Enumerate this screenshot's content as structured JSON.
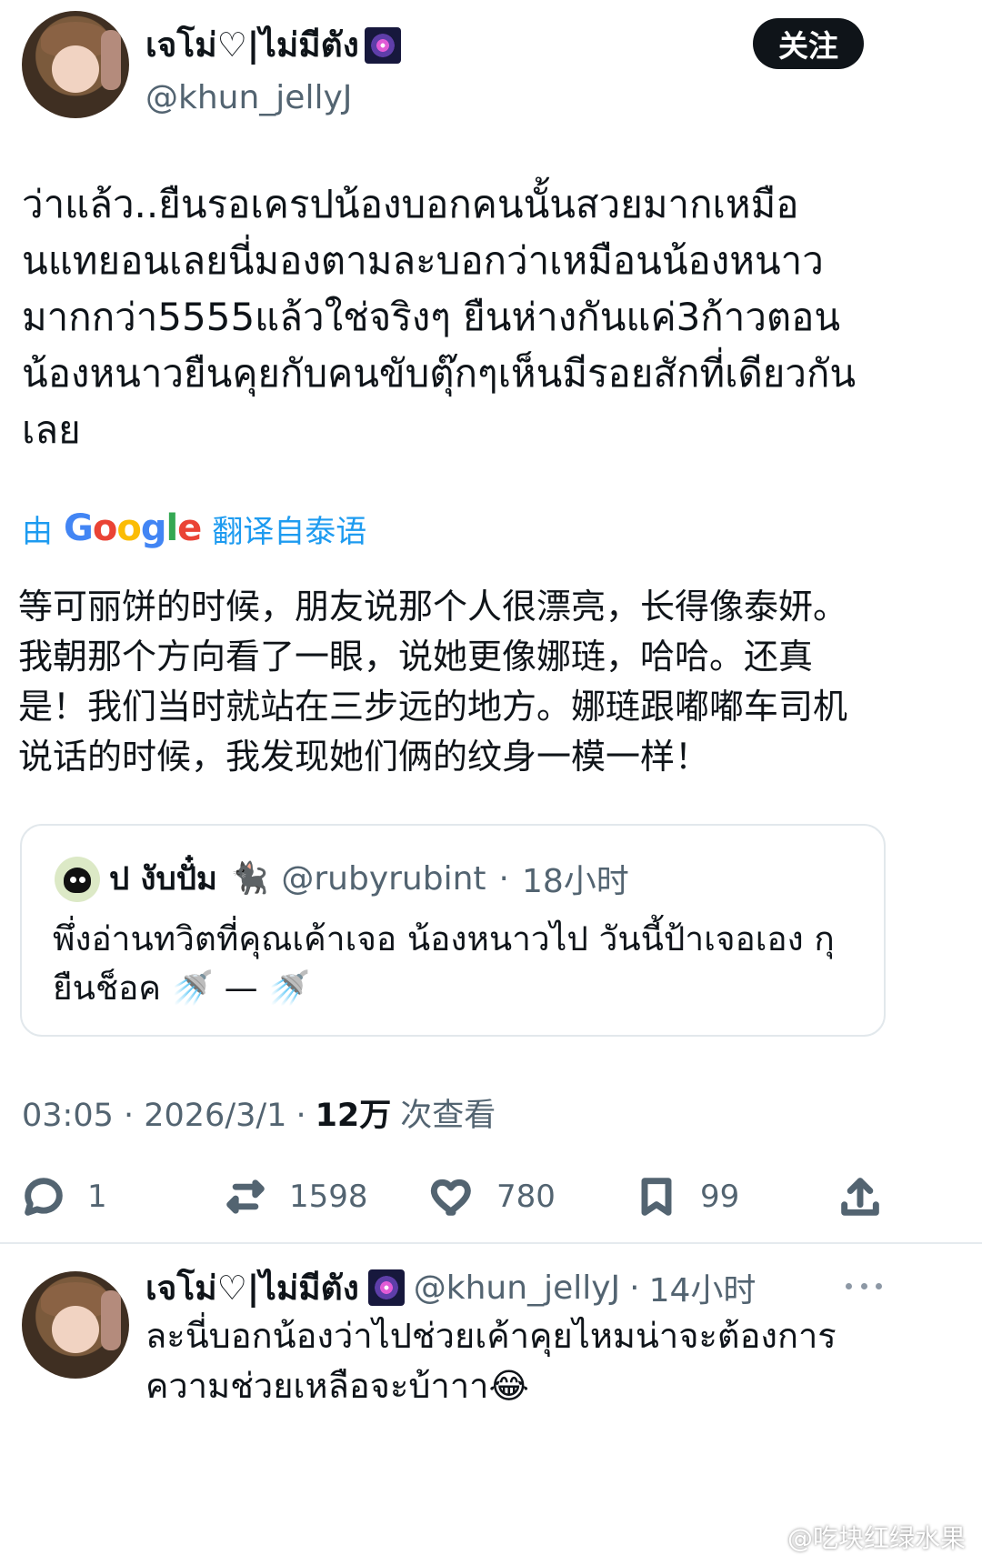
{
  "post": {
    "author": {
      "display_name": "เจโม่♡|ไม่มีตัง",
      "handle": "@khun_jellyJ",
      "badge_icon": "firework-icon"
    },
    "follow_label": "关注",
    "text": "ว่าแล้ว..ยืนรอเครปน้องบอกคนนั้นสวยมากเหมือนแทยอนเลยนี่มองตามละบอกว่าเหมือนน้องหนาวมากกว่า5555แล้วใช่จริงๆ ยืนห่างกันแค่3ก้าวตอนน้องหนาวยืนคุยกับคนขับตุ๊กๆเห็นมีรอยสักที่เดียวกันเลย",
    "translation_prefix": "由",
    "translation_brand": "Google",
    "translation_suffix": "翻译自泰语",
    "translated_text": "等可丽饼的时候，朋友说那个人很漂亮，长得像泰妍。我朝那个方向看了一眼，说她更像娜琏，哈哈。还真是！我们当时就站在三步远的地方。娜琏跟嘟嘟车司机说话的时候，我发现她们俩的纹身一模一样！",
    "quote": {
      "display_name": "ป งับปั๋ม",
      "handle": "@rubyrubint",
      "time": "18小时",
      "text": "พึ่งอ่านทวิตที่คุณเค้าเจอ น้องหนาวไป วันนี้ป้าเจอเอง กุยืนช็อค 🚿 — 🚿",
      "emoji_icon": "cat-icon"
    },
    "timestamp": "03:05 · 2026/3/1",
    "views_count": "12万",
    "views_label": "次查看",
    "actions": {
      "reply": "1",
      "retweet": "1598",
      "like": "780",
      "bookmark": "99"
    },
    "colors": {
      "accent": "#1d9bf0",
      "text": "#0f1419",
      "muted": "#536471"
    }
  },
  "reply": {
    "display_name": "เจโม่♡|ไม่มีตัง",
    "handle": "@khun_jellyJ",
    "time": "14小时",
    "text": "ละนี่บอกน้องว่าไปช่วยเค้าคุยไหมน่าจะต้องการความช่วยเหลือจะบ้าาา😂"
  },
  "watermark": "@吃块红绿水果"
}
